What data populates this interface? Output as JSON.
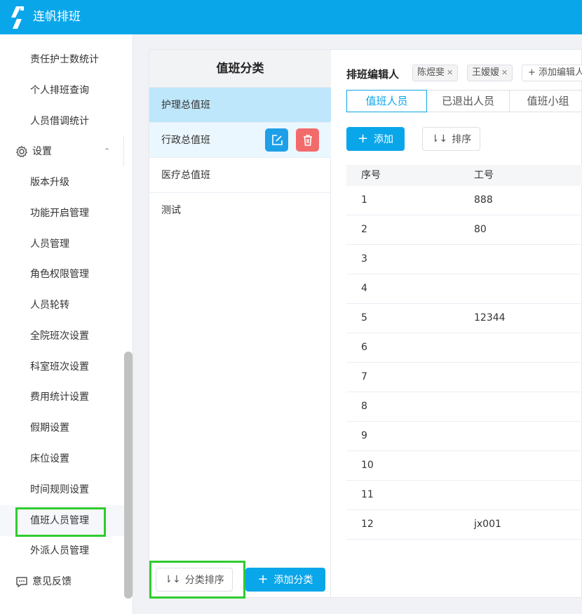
{
  "app": {
    "title": "连帆排班"
  },
  "sidebar": {
    "items": [
      {
        "label": "责任护士数统计"
      },
      {
        "label": "个人排班查询"
      },
      {
        "label": "人员借调统计"
      }
    ],
    "settings_group": {
      "label": "设置",
      "icon": "gear-icon"
    },
    "settings_items": [
      {
        "label": "版本升级"
      },
      {
        "label": "功能开启管理"
      },
      {
        "label": "人员管理"
      },
      {
        "label": "角色权限管理"
      },
      {
        "label": "人员轮转"
      },
      {
        "label": "全院班次设置"
      },
      {
        "label": "科室班次设置"
      },
      {
        "label": "费用统计设置"
      },
      {
        "label": "假期设置"
      },
      {
        "label": "床位设置"
      },
      {
        "label": "时间规则设置"
      },
      {
        "label": "值班人员管理"
      },
      {
        "label": "外派人员管理"
      }
    ],
    "feedback": {
      "label": "意见反馈",
      "icon": "chat-icon"
    }
  },
  "category_panel": {
    "title": "值班分类",
    "items": [
      {
        "label": "护理总值班"
      },
      {
        "label": "行政总值班"
      },
      {
        "label": "医疗总值班"
      },
      {
        "label": "测试"
      }
    ],
    "sort_button": "分类排序",
    "add_button": "添加分类"
  },
  "main": {
    "editors_label": "排班编辑人",
    "editors": [
      {
        "name": "陈煜斐"
      },
      {
        "name": "王嫒嫒"
      }
    ],
    "add_editor": "+ 添加编辑人",
    "tabs": [
      {
        "label": "值班人员"
      },
      {
        "label": "已退出人员"
      },
      {
        "label": "值班小组"
      }
    ],
    "add_button": "添加",
    "sort_button": "排序",
    "table": {
      "columns": [
        "序号",
        "工号"
      ],
      "rows": [
        [
          "1",
          "888"
        ],
        [
          "2",
          "80"
        ],
        [
          "3",
          ""
        ],
        [
          "4",
          ""
        ],
        [
          "5",
          "12344"
        ],
        [
          "6",
          ""
        ],
        [
          "7",
          ""
        ],
        [
          "8",
          ""
        ],
        [
          "9",
          ""
        ],
        [
          "10",
          ""
        ],
        [
          "11",
          ""
        ],
        [
          "12",
          "jx001"
        ]
      ]
    }
  },
  "colors": {
    "brand": "#0aa6ea",
    "highlight": "#2fcc2f",
    "danger": "#f26b6b",
    "selected_row": "#bfe7fb"
  }
}
